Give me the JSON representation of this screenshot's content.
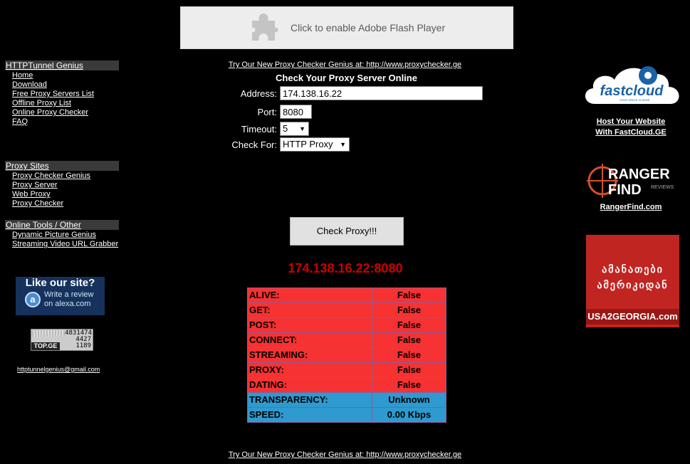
{
  "flash": {
    "text": "Click to enable Adobe Flash Player",
    "icon": "puzzle-piece-icon"
  },
  "sidebar": {
    "sections": [
      {
        "title": "HTTPTunnel Genius",
        "items": [
          "Home",
          "Download",
          "Free Proxy Servers List",
          "Offline Proxy List",
          "Online Proxy Checker",
          "FAQ"
        ]
      },
      {
        "title": "Proxy Sites",
        "items": [
          "Proxy Checker Genius",
          "Proxy Server",
          "Web Proxy",
          "Proxy Checker"
        ]
      },
      {
        "title": "Online Tools / Other",
        "items": [
          "Dynamic Picture Genius",
          "Streaming Video URL Grabber"
        ]
      }
    ],
    "alexa": {
      "title": "Like our site?",
      "line1": "Write a review",
      "line2": "on alexa.com",
      "logo": "a"
    },
    "counter": {
      "total": "4831474",
      "today": "4427",
      "online": "1189",
      "brand": "TOP.GE"
    },
    "email": "httptunnelgenius@gmail.com"
  },
  "main": {
    "promo_top": "Try Our New Proxy Checker Genius at: http://www.proxychecker.ge",
    "title": "Check Your Proxy Server Online",
    "address_label": "Address:",
    "address_value": "174.138.16.22",
    "port_label": "Port:",
    "port_value": "8080",
    "timeout_label": "Timeout:",
    "timeout_value": "5",
    "checkfor_label": "Check For:",
    "checkfor_value": "HTTP Proxy",
    "check_button": "Check Proxy!!!",
    "result_title": "174.138.16.22:8080",
    "results": [
      {
        "key": "ALIVE:",
        "value": "False",
        "status": "red"
      },
      {
        "key": "GET:",
        "value": "False",
        "status": "red"
      },
      {
        "key": "POST:",
        "value": "False",
        "status": "red"
      },
      {
        "key": "CONNECT:",
        "value": "False",
        "status": "red"
      },
      {
        "key": "STREAMING:",
        "value": "False",
        "status": "red"
      },
      {
        "key": "PROXY:",
        "value": "False",
        "status": "red"
      },
      {
        "key": "DATING:",
        "value": "False",
        "status": "red"
      },
      {
        "key": "TRANSPARENCY:",
        "value": "Unknown",
        "status": "blue"
      },
      {
        "key": "SPEED:",
        "value": "0.00 Kbps",
        "status": "blue"
      }
    ],
    "promo_bottom": "Try Our New Proxy Checker Genius at: http://www.proxychecker.ge"
  },
  "right": {
    "fastcloud": {
      "logo_text": "fastcloud",
      "tagline": "YOUR SPACE IS HERE",
      "link_line1": "Host Your Website",
      "link_line2": "With FastCloud.GE"
    },
    "ranger": {
      "line1": "RANGER",
      "line2": "FIND",
      "tag": "REVIEWS",
      "link": "RangerFind.com"
    },
    "usa": {
      "line1": "ამანათები",
      "line2": "ამერიკიდან",
      "url": "USA2GEORGIA.com"
    }
  },
  "colors": {
    "fail": "#f63232",
    "info": "#2e9ad0",
    "result_title": "#cc0000",
    "background": "#000000"
  }
}
